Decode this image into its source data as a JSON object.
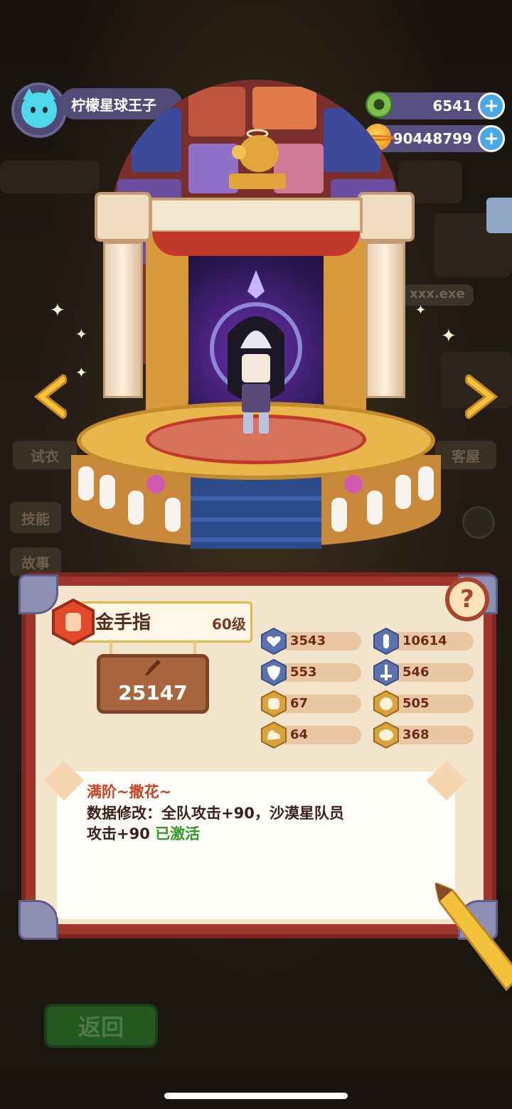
{
  "player": {
    "name": "柠檬星球王子",
    "avatar_icon": "cat-face-icon"
  },
  "resources": [
    {
      "name": "donut-currency-icon",
      "value": "6541",
      "color": "#7cc24a"
    },
    {
      "name": "planet-coin-icon",
      "value": "90448799",
      "color": "#f0a72c"
    }
  ],
  "cookie": {
    "name": "金手指",
    "level": "60级",
    "class_icon": "fist-class-icon",
    "power_icon": "sword-icon",
    "power": "25147"
  },
  "stats": [
    {
      "icon": "heart-icon",
      "value": "3543"
    },
    {
      "icon": "attack-icon",
      "value": "10614"
    },
    {
      "icon": "shield-icon",
      "value": "553"
    },
    {
      "icon": "sword-down-icon",
      "value": "546"
    },
    {
      "icon": "fist-icon",
      "value": "67"
    },
    {
      "icon": "smile-icon",
      "value": "505"
    },
    {
      "icon": "muscle-icon",
      "value": "64"
    },
    {
      "icon": "brain-icon",
      "value": "368"
    }
  ],
  "skill": {
    "title": "满阶~撒花~",
    "line1": "数据修改：全队攻击+90，沙漠星队员",
    "line2": "攻击+90",
    "status": "已激活"
  },
  "background": {
    "tab_left": "试衣",
    "tab_right": "客屋",
    "side_tab_1": "技能",
    "side_tab_2": "故事",
    "file_label": "xxx.exe",
    "back_label": "返回"
  },
  "colors": {
    "panel": "#a0352e",
    "parchment": "#f3e5cb",
    "accent_plus": "#4aa7e8"
  }
}
